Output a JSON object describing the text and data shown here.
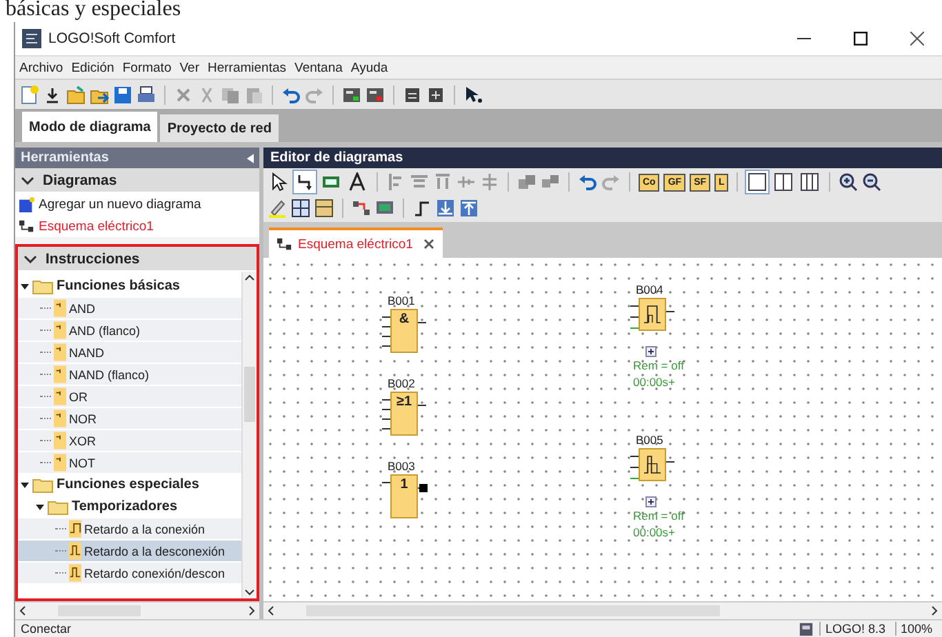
{
  "caption": "básicas y especiales",
  "window": {
    "title": "LOGO!Soft Comfort"
  },
  "menu": [
    "Archivo",
    "Edición",
    "Formato",
    "Ver",
    "Herramientas",
    "Ventana",
    "Ayuda"
  ],
  "mode_tabs": [
    {
      "label": "Modo de diagrama",
      "selected": true
    },
    {
      "label": "Proyecto de red",
      "selected": false
    }
  ],
  "tools_panel": {
    "title": "Herramientas",
    "diagrams": {
      "title": "Diagramas",
      "expanded": true,
      "items": [
        {
          "label": "Agregar un nuevo diagrama",
          "kind": "add"
        },
        {
          "label": "Esquema eléctrico1",
          "kind": "diagram"
        }
      ]
    },
    "instructions": {
      "title": "Instrucciones",
      "expanded": true,
      "tree": [
        {
          "label": "Funciones básicas",
          "kind": "folder",
          "expanded": true,
          "children": [
            {
              "label": "AND",
              "kind": "gate",
              "selected": false
            },
            {
              "label": "AND (flanco)",
              "kind": "gate",
              "selected": false
            },
            {
              "label": "NAND",
              "kind": "gate",
              "selected": false
            },
            {
              "label": "NAND (flanco)",
              "kind": "gate",
              "selected": false
            },
            {
              "label": "OR",
              "kind": "gate",
              "selected": false
            },
            {
              "label": "NOR",
              "kind": "gate",
              "selected": false
            },
            {
              "label": "XOR",
              "kind": "gate",
              "selected": false
            },
            {
              "label": "NOT",
              "kind": "gate",
              "selected": false
            }
          ]
        },
        {
          "label": "Funciones especiales",
          "kind": "folder",
          "expanded": true,
          "children": [
            {
              "label": "Temporizadores",
              "kind": "folder",
              "expanded": true,
              "children": [
                {
                  "label": "Retardo a la conexión",
                  "kind": "on_delay",
                  "selected": false
                },
                {
                  "label": "Retardo a la desconexión",
                  "kind": "off_delay",
                  "selected": true
                },
                {
                  "label": "Retardo conexión/descon",
                  "kind": "on_off_delay",
                  "selected": false
                }
              ]
            }
          ]
        }
      ]
    }
  },
  "editor": {
    "title": "Editor de diagramas",
    "tools": [
      {
        "kind": "select",
        "selected": false
      },
      {
        "kind": "connect",
        "selected": true
      },
      {
        "kind": "constant",
        "selected": false
      },
      {
        "kind": "text",
        "selected": false
      }
    ],
    "palette": [
      "Co",
      "GF",
      "SF",
      "L"
    ],
    "views": [
      {
        "selected": true
      },
      {
        "selected": false
      },
      {
        "selected": false
      }
    ],
    "tabs": [
      {
        "label": "Esquema eléctrico1",
        "selected": true
      }
    ],
    "blocks": [
      {
        "label": "B001",
        "kind": "and",
        "symbol": "&",
        "negated_output": false
      },
      {
        "label": "B002",
        "kind": "or",
        "symbol": "≥1",
        "negated_output": false
      },
      {
        "label": "B003",
        "kind": "not",
        "symbol": "1",
        "negated_output": true
      },
      {
        "label": "B004",
        "kind": "on_delay",
        "negated_output": false,
        "params": [
          "Rem = off",
          "00:00s+"
        ]
      },
      {
        "label": "B005",
        "kind": "off_delay",
        "negated_output": false,
        "params": [
          "Rem = off",
          "00:00s+"
        ]
      }
    ]
  },
  "status_bar": {
    "left": "Conectar",
    "version": "LOGO! 8.3",
    "zoom": "100%"
  }
}
